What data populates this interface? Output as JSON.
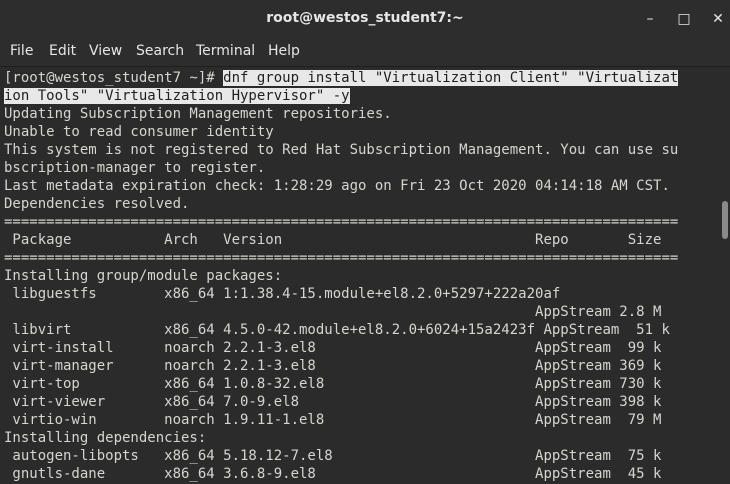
{
  "window": {
    "title": "root@westos_student7:~"
  },
  "controls": {
    "minimize": "–",
    "maximize": "□",
    "close": "✕"
  },
  "menu": [
    "File",
    "Edit",
    "View",
    "Search",
    "Terminal",
    "Help"
  ],
  "terminal": {
    "prompt": "[root@westos_student7 ~]# ",
    "command_line1": "dnf group install \"Virtualization Client\" \"Virtualizat",
    "command_line2": "ion Tools\" \"Virtualization Hypervisor\" -y",
    "output": [
      "Updating Subscription Management repositories.",
      "Unable to read consumer identity",
      "This system is not registered to Red Hat Subscription Management. You can use su",
      "bscription-manager to register.",
      "Last metadata expiration check: 1:28:29 ago on Fri 23 Oct 2020 04:14:18 AM CST.",
      "Dependencies resolved.",
      "================================================================================",
      " Package           Arch   Version                              Repo       Size",
      "================================================================================",
      "Installing group/module packages:",
      " libguestfs        x86_64 1:1.38.4-15.module+el8.2.0+5297+222a20af",
      "                                                               AppStream 2.8 M",
      " libvirt           x86_64 4.5.0-42.module+el8.2.0+6024+15a2423f AppStream  51 k",
      " virt-install      noarch 2.2.1-3.el8                          AppStream  99 k",
      " virt-manager      noarch 2.2.1-3.el8                          AppStream 369 k",
      " virt-top          x86_64 1.0.8-32.el8                         AppStream 730 k",
      " virt-viewer       x86_64 7.0-9.el8                            AppStream 398 k",
      " virtio-win        noarch 1.9.11-1.el8                         AppStream  79 M",
      "Installing dependencies:",
      " autogen-libopts   x86_64 5.18.12-7.el8                        AppStream  75 k",
      " gnutls-dane       x86_64 3.6.8-9.el8                          AppStream  45 k"
    ]
  }
}
